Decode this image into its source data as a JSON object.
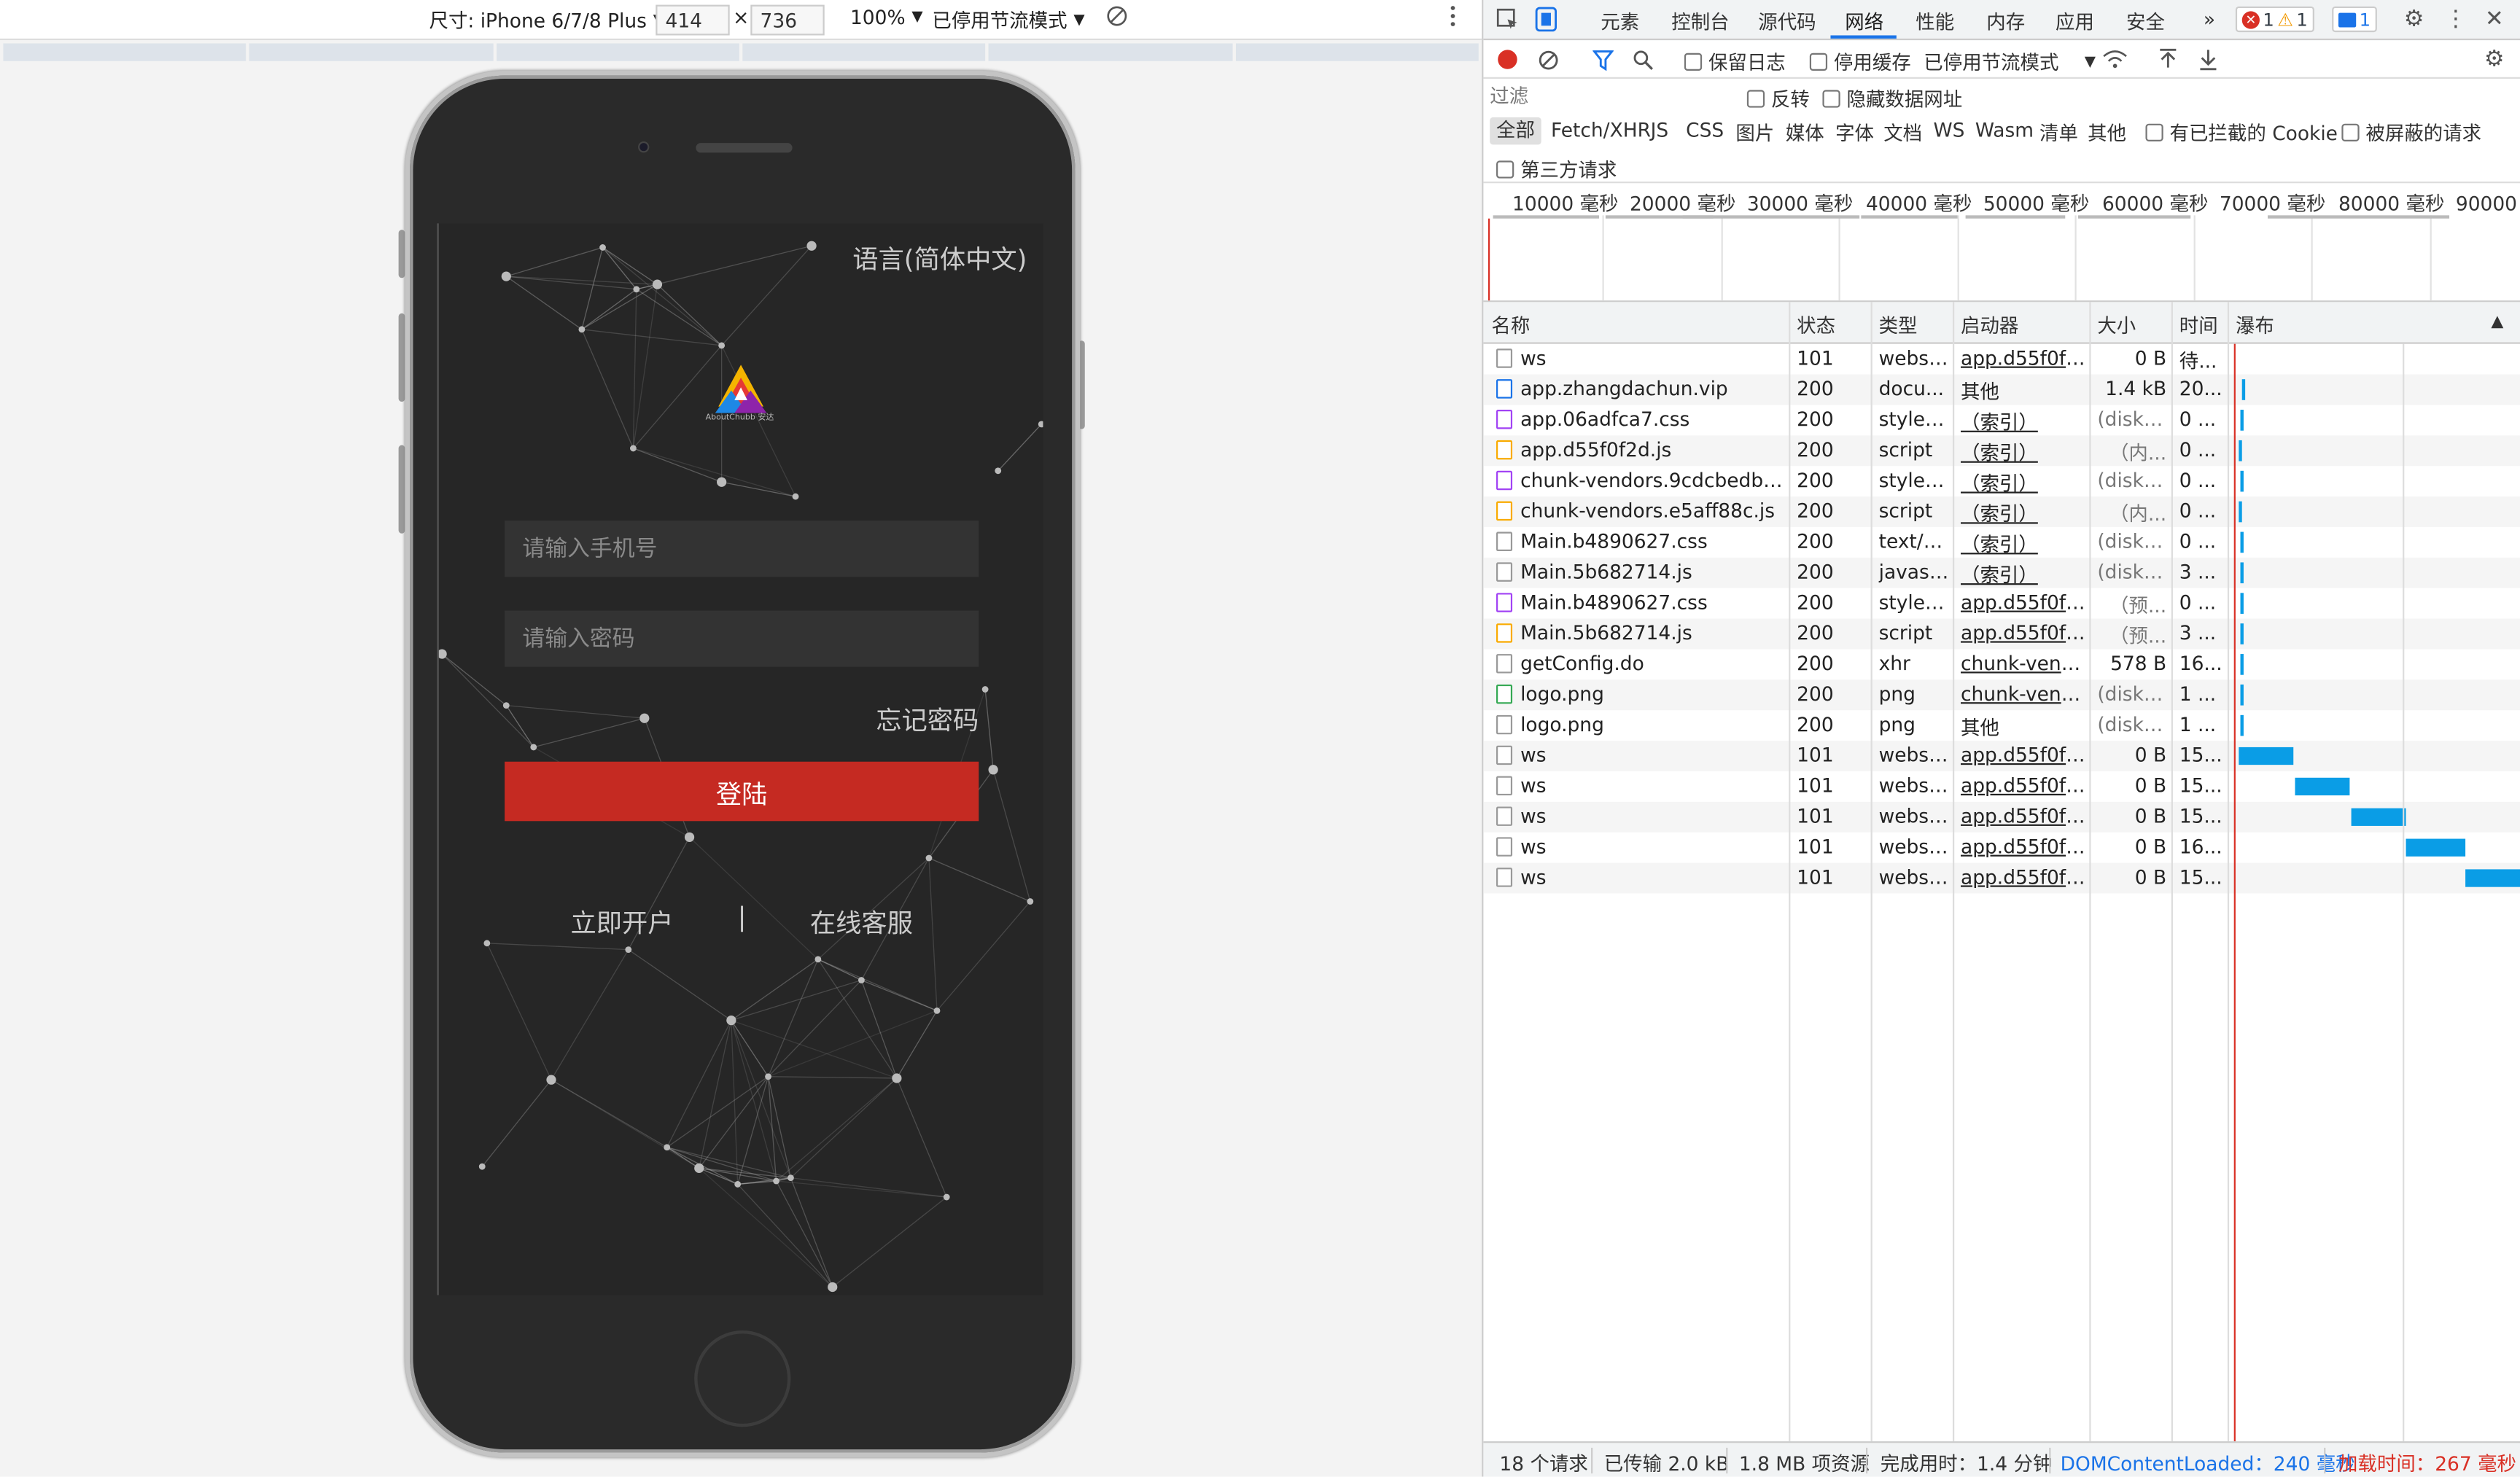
{
  "device_toolbar": {
    "size_label": "尺寸: iPhone 6/7/8 Plus",
    "width_value": "414",
    "times": "×",
    "height_value": "736",
    "zoom": "100%",
    "throttle": "已停用节流模式",
    "rotate_icon": "rotate-icon",
    "more_icon": "more-vert-icon"
  },
  "phone": {
    "language_link": "语言(简体中文)",
    "logo_text": "AboutChubb 安达",
    "phone_placeholder": "请输入手机号",
    "password_placeholder": "请输入密码",
    "forgot_password": "忘记密码",
    "login_button": "登陆",
    "open_account": "立即开户",
    "separator": "|",
    "online_service": "在线客服"
  },
  "devtools": {
    "tabs": [
      "元素",
      "控制台",
      "源代码",
      "网络",
      "性能",
      "内存",
      "应用",
      "安全"
    ],
    "active_tab": "网络",
    "more_tabs": "»",
    "errors_count": "1",
    "warnings_count": "1",
    "messages_count": "1",
    "toolbar": {
      "preserve_log": "保留日志",
      "disable_cache": "停用缓存",
      "throttle": "已停用节流模式"
    },
    "filter": {
      "placeholder": "过滤",
      "invert": "反转",
      "hide_data_urls": "隐藏数据网址"
    },
    "types": [
      "全部",
      "Fetch/XHR",
      "JS",
      "CSS",
      "图片",
      "媒体",
      "字体",
      "文档",
      "WS",
      "Wasm",
      "清单",
      "其他"
    ],
    "blocked_cookies": "有已拦截的 Cookie",
    "blocked_requests": "被屏蔽的请求",
    "third_party": "第三方请求",
    "overview_ticks": [
      "10000 毫秒",
      "20000 毫秒",
      "30000 毫秒",
      "40000 毫秒",
      "50000 毫秒",
      "60000 毫秒",
      "70000 毫秒",
      "80000 毫秒",
      "90000 毫"
    ],
    "columns": [
      "名称",
      "状态",
      "类型",
      "启动器",
      "大小",
      "时间",
      "瀑布"
    ],
    "rows": [
      {
        "name": "ws",
        "status": "101",
        "type": "webso...",
        "initiator": "app.d55f0f2d...",
        "size": "0 B",
        "time": "待...",
        "icon": "doc-icon"
      },
      {
        "name": "app.zhangdachun.vip",
        "status": "200",
        "type": "docu...",
        "initiator": "其他",
        "size": "1.4 kB",
        "time": "20...",
        "icon": "html-icon"
      },
      {
        "name": "app.06adfca7.css",
        "status": "200",
        "type": "styles...",
        "initiator": "（索引）",
        "size": "(disk c...",
        "time": "0 ...",
        "icon": "css-icon"
      },
      {
        "name": "app.d55f0f2d.js",
        "status": "200",
        "type": "script",
        "initiator": "（索引）",
        "size": "（内...",
        "time": "0 ...",
        "icon": "js-icon"
      },
      {
        "name": "chunk-vendors.9cdcbedb.css",
        "status": "200",
        "type": "styles...",
        "initiator": "（索引）",
        "size": "(disk c...",
        "time": "0 ...",
        "icon": "css-icon"
      },
      {
        "name": "chunk-vendors.e5aff88c.js",
        "status": "200",
        "type": "script",
        "initiator": "（索引）",
        "size": "（内...",
        "time": "0 ...",
        "icon": "js-icon"
      },
      {
        "name": "Main.b4890627.css",
        "status": "200",
        "type": "text/css",
        "initiator": "（索引）",
        "size": "(disk c...",
        "time": "0 ...",
        "icon": "doc-icon"
      },
      {
        "name": "Main.5b682714.js",
        "status": "200",
        "type": "javasc...",
        "initiator": "（索引）",
        "size": "(disk c...",
        "time": "3 ...",
        "icon": "doc-icon"
      },
      {
        "name": "Main.b4890627.css",
        "status": "200",
        "type": "styles...",
        "initiator": "app.d55f0f2d...",
        "size": "（预...",
        "time": "0 ...",
        "icon": "css-icon"
      },
      {
        "name": "Main.5b682714.js",
        "status": "200",
        "type": "script",
        "initiator": "app.d55f0f2d...",
        "size": "（预...",
        "time": "3 ...",
        "icon": "js-icon"
      },
      {
        "name": "getConfig.do",
        "status": "200",
        "type": "xhr",
        "initiator": "chunk-vendo...",
        "size": "578 B",
        "time": "16...",
        "icon": "doc-icon"
      },
      {
        "name": "logo.png",
        "status": "200",
        "type": "png",
        "initiator": "chunk-vendo...",
        "size": "(disk c...",
        "time": "1 ...",
        "icon": "image-icon"
      },
      {
        "name": "logo.png",
        "status": "200",
        "type": "png",
        "initiator": "其他",
        "size": "(disk c...",
        "time": "1 ...",
        "icon": "doc-icon"
      },
      {
        "name": "ws",
        "status": "101",
        "type": "webso...",
        "initiator": "app.d55f0f2d...",
        "size": "0 B",
        "time": "15...",
        "icon": "doc-icon"
      },
      {
        "name": "ws",
        "status": "101",
        "type": "webso...",
        "initiator": "app.d55f0f2d...",
        "size": "0 B",
        "time": "15...",
        "icon": "doc-icon"
      },
      {
        "name": "ws",
        "status": "101",
        "type": "webso...",
        "initiator": "app.d55f0f2d...",
        "size": "0 B",
        "time": "15...",
        "icon": "doc-icon"
      },
      {
        "name": "ws",
        "status": "101",
        "type": "webso...",
        "initiator": "app.d55f0f2d...",
        "size": "0 B",
        "time": "16...",
        "icon": "doc-icon"
      },
      {
        "name": "ws",
        "status": "101",
        "type": "webso...",
        "initiator": "app.d55f0f2d...",
        "size": "0 B",
        "time": "15...",
        "icon": "doc-icon"
      }
    ],
    "status_bar": {
      "requests": "18 个请求",
      "transferred": "已传输 2.0 kB",
      "resources": "1.8 MB 项资源",
      "finish": "完成用时：1.4 分钟",
      "dom_content_loaded": "DOMContentLoaded：240 毫秒",
      "load": "加载时间：267 毫秒"
    },
    "colors": {
      "accent": "#1a73e8",
      "record": "#d93025",
      "waterfall": "#0a9de6",
      "login_button": "#c52a22"
    }
  }
}
